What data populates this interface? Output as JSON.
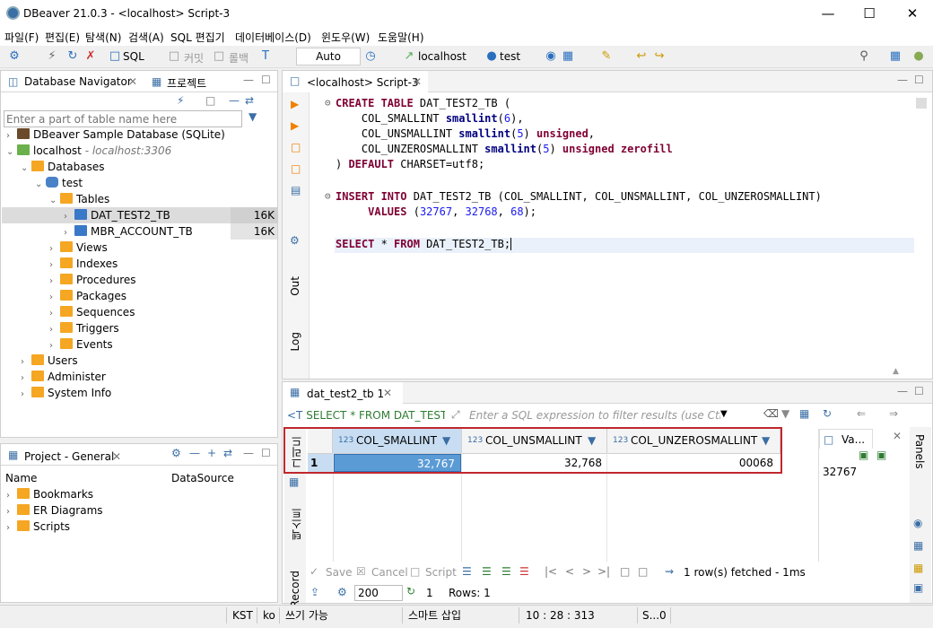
{
  "window": {
    "title": "DBeaver 21.0.3 - <localhost> Script-3",
    "min_icon": "minimize-icon",
    "max_icon": "maximize-icon",
    "close_icon": "close-icon"
  },
  "menu": [
    "파일(F)",
    "편집(E)",
    "탐색(N)",
    "검색(A)",
    "SQL 편집기",
    "데이터베이스(D)",
    "윈도우(W)",
    "도움말(H)"
  ],
  "toolbar": {
    "sql": "SQL",
    "commit": "커밋",
    "rollback": "롤백",
    "auto": "Auto",
    "connection": "localhost",
    "database": "test"
  },
  "navigator": {
    "tab": "Database Navigator",
    "tab2": "프로젝트",
    "filter_placeholder": "Enter a part of table name here",
    "items": [
      {
        "label": "DBeaver Sample Database (SQLite)"
      },
      {
        "label": "localhost",
        "sub": " - localhost:3306"
      },
      {
        "label": "Databases"
      },
      {
        "label": "test"
      },
      {
        "label": "Tables"
      },
      {
        "label": "DAT_TEST2_TB",
        "size": "16K"
      },
      {
        "label": "MBR_ACCOUNT_TB",
        "size": "16K"
      },
      {
        "label": "Views"
      },
      {
        "label": "Indexes"
      },
      {
        "label": "Procedures"
      },
      {
        "label": "Packages"
      },
      {
        "label": "Sequences"
      },
      {
        "label": "Triggers"
      },
      {
        "label": "Events"
      },
      {
        "label": "Users"
      },
      {
        "label": "Administer"
      },
      {
        "label": "System Info"
      }
    ]
  },
  "project": {
    "tab": "Project - General",
    "col_name": "Name",
    "col_ds": "DataSource",
    "items": [
      "Bookmarks",
      "ER Diagrams",
      "Scripts"
    ]
  },
  "editor": {
    "tab": "<localhost> Script-3",
    "side_out": "Out",
    "side_log": "Log"
  },
  "results": {
    "tab": "dat_test2_tb 1",
    "query": "SELECT * FROM DAT_TEST2",
    "filter_placeholder": "Enter a SQL expression to filter results (use Ctrl+S",
    "columns": [
      {
        "type": "123",
        "name": "COL_SMALLINT"
      },
      {
        "type": "123",
        "name": "COL_UNSMALLINT"
      },
      {
        "type": "123",
        "name": "COL_UNZEROSMALLINT"
      }
    ],
    "row_num": "1",
    "values": [
      "32,767",
      "32,768",
      "00068"
    ],
    "side_grid": "그리드",
    "side_text": "텍스트",
    "side_record": "Record",
    "save": "Save",
    "cancel": "Cancel",
    "script": "Script",
    "fetched": "1 row(s) fetched - 1ms",
    "limit": "200",
    "refresh_count": "1",
    "rows": "Rows: 1",
    "value_panel_tab": "Va...",
    "value_panel_value": "32767",
    "panels_label": "Panels"
  },
  "status": {
    "tz": "KST",
    "lang": "ko",
    "mode": "쓰기 가능",
    "insert": "스마트 삽입",
    "pos": "10 : 28 : 313",
    "sel": "S...0"
  }
}
